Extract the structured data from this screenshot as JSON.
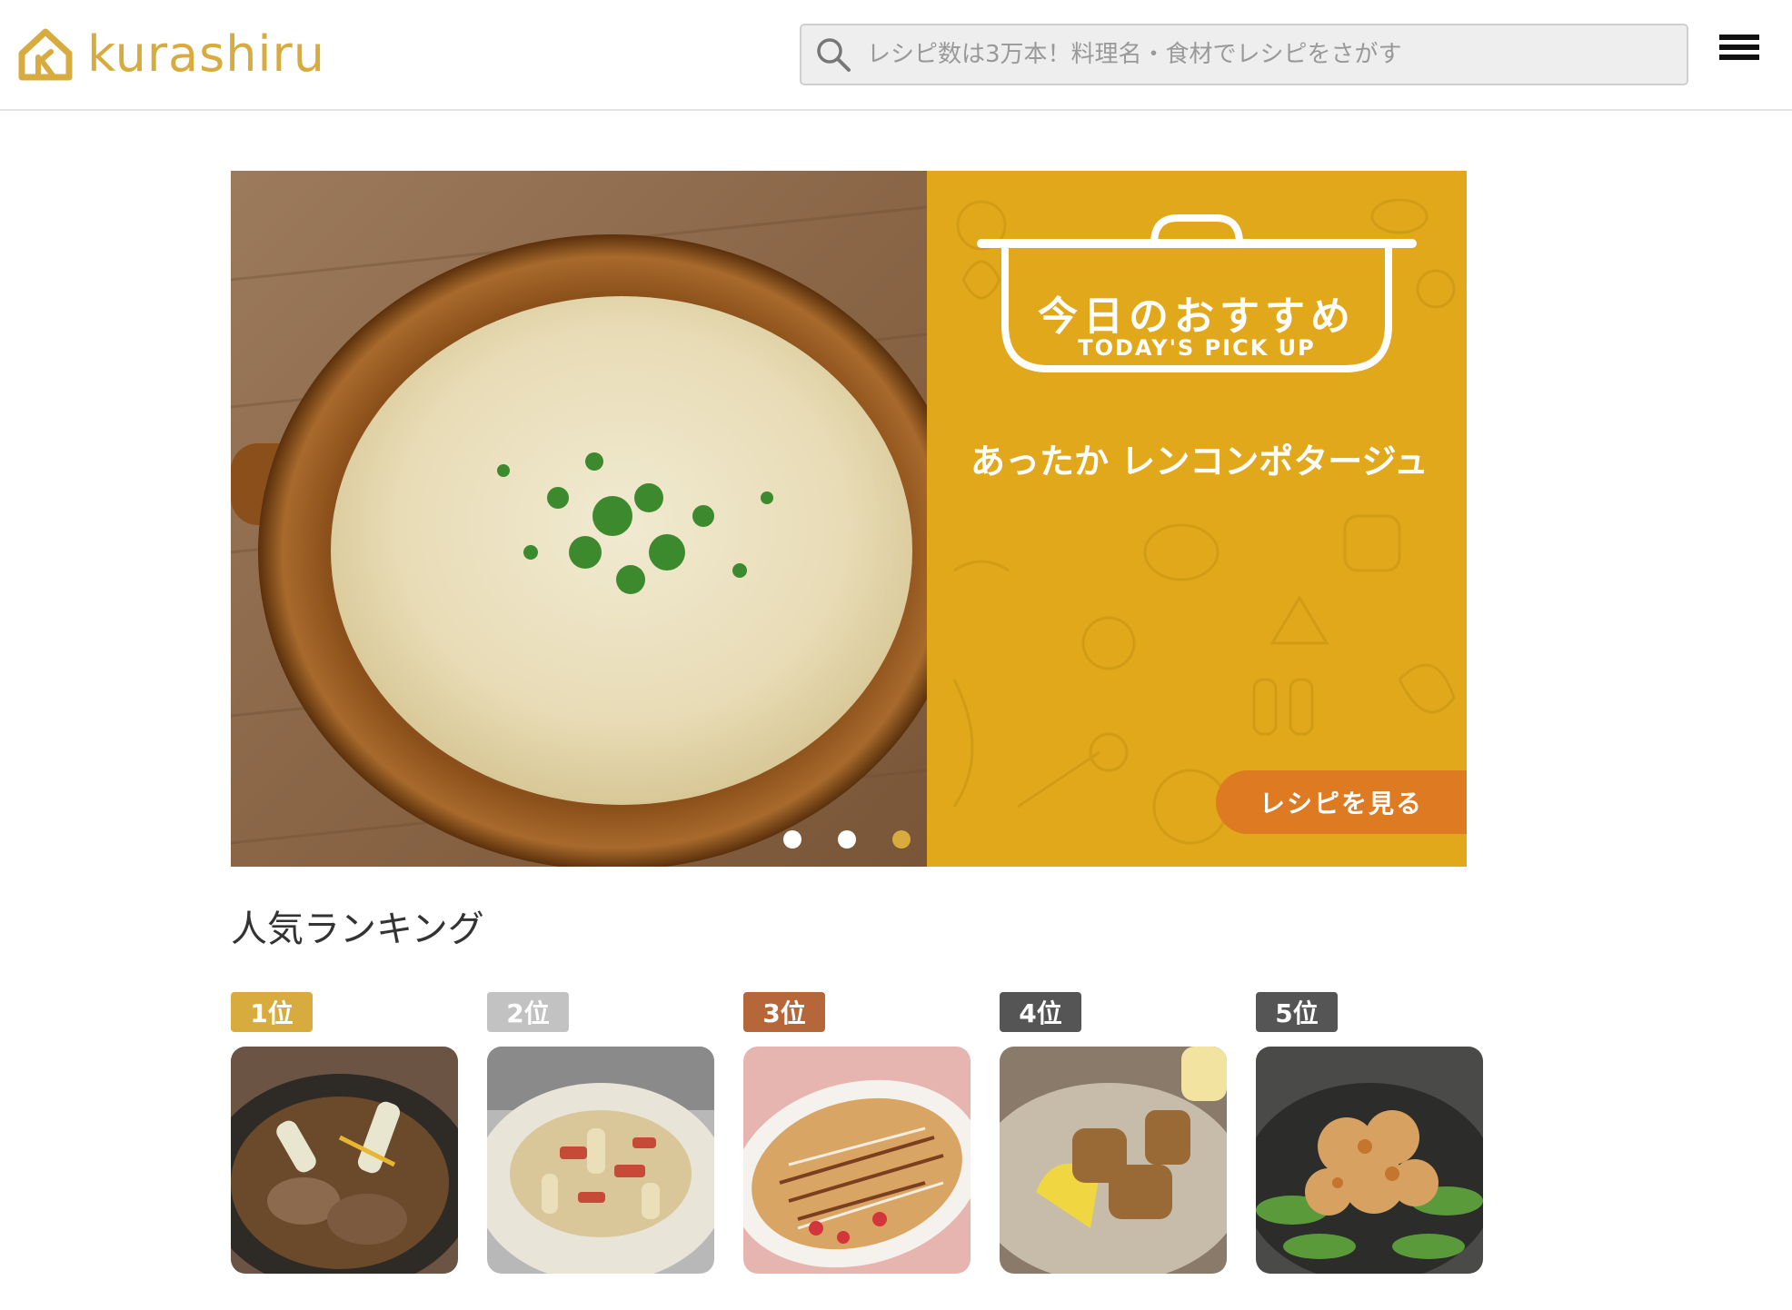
{
  "header": {
    "logo_text": "kurashiru",
    "search_placeholder": "レシピ数は3万本！料理名・食材でレシピをさがす",
    "brand_color": "#d8ab3e"
  },
  "hero": {
    "pick_title": "今日のおすすめ",
    "pick_subtitle": "TODAY'S PICK UP",
    "recipe_name": "あったか レンコンポタージュ",
    "cta_label": "レシピを見る",
    "panel_color": "#e0a81a",
    "cta_color": "#dd7a22",
    "carousel": {
      "slide_count": 3,
      "active_index": 2
    }
  },
  "ranking": {
    "title": "人気ランキング",
    "items": [
      {
        "rank": "1位",
        "badge_color": "#d8ab3e"
      },
      {
        "rank": "2位",
        "badge_color": "#c2c2c2"
      },
      {
        "rank": "3位",
        "badge_color": "#b5673a"
      },
      {
        "rank": "4位",
        "badge_color": "#555555"
      },
      {
        "rank": "5位",
        "badge_color": "#555555"
      }
    ]
  }
}
